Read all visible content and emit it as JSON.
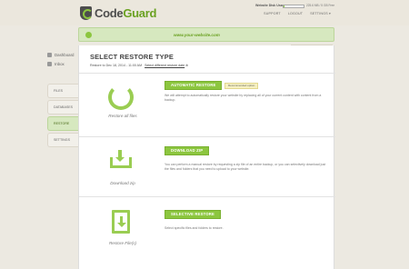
{
  "header": {
    "logo_code": "Code",
    "logo_guard": "Guard",
    "nav": [
      "SUPPORT",
      "LOGOUT",
      "SETTINGS ▾"
    ]
  },
  "site": {
    "url": "www.your-website.com",
    "disk_label": "Website Disk Usage",
    "disk_value": "225.6 MB / 5 GB Free",
    "disk_fraction": 0.05,
    "upgrade_label": "Upgrade for more space"
  },
  "left_nav": {
    "items": [
      {
        "label": "Dashboard",
        "icon": "dashboard-icon"
      },
      {
        "label": "Inbox",
        "icon": "inbox-icon"
      }
    ],
    "tabs": [
      "FILES",
      "DATABASES",
      "RESTORE",
      "SETTINGS"
    ],
    "active_tab": "RESTORE"
  },
  "main": {
    "title": "SELECT RESTORE TYPE",
    "restore_to": "Restore to Dec 18, 2014 - 11:00 AM",
    "select_date_link": "Select different restore date",
    "options": [
      {
        "button": "AUTOMATIC RESTORE",
        "badge": "Recommended option",
        "caption": "Restore all files",
        "icon": "refresh-icon",
        "desc": "We will attempt to automatically restore your website by replacing all of your current content with content from a backup."
      },
      {
        "button": "DOWNLOAD ZIP",
        "caption": "Download zip",
        "icon": "download-tray-icon",
        "desc": "You can perform a manual restore by requesting a zip file of an entire backup, or you can selectively download just the files and folders that you need to upload to your website."
      },
      {
        "button": "SELECTIVE RESTORE",
        "caption": "Restore File(s)",
        "icon": "file-download-icon",
        "desc": "Select specific files and folders to restore."
      }
    ]
  },
  "colors": {
    "accent": "#8cc63f",
    "accent_light": "#d6e8bf",
    "background": "#ece9e1"
  }
}
